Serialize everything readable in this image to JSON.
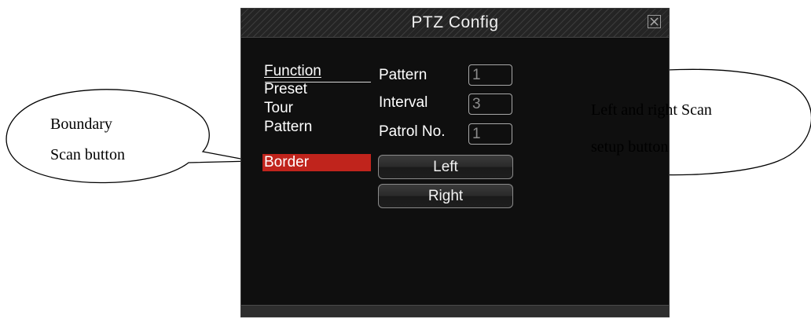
{
  "window": {
    "title": "PTZ Config",
    "close_icon": "close-x-icon"
  },
  "menu": {
    "items": [
      {
        "label": "Function",
        "state": "underlined"
      },
      {
        "label": "Preset"
      },
      {
        "label": "Tour"
      },
      {
        "label": "Pattern"
      },
      {
        "label": "Border",
        "state": "selected"
      }
    ],
    "selected_color": "#c0241c"
  },
  "form": {
    "pattern_label": "Pattern",
    "pattern_value": "1",
    "interval_label": "Interval",
    "interval_value": "3",
    "patrol_label": "Patrol No.",
    "patrol_value": "1",
    "left_button": "Left",
    "right_button": "Right"
  },
  "callouts": {
    "boundary_line1": "Boundary",
    "boundary_line2": "Scan button",
    "scan_line1": "Left and right Scan",
    "scan_line2": "setup button"
  }
}
